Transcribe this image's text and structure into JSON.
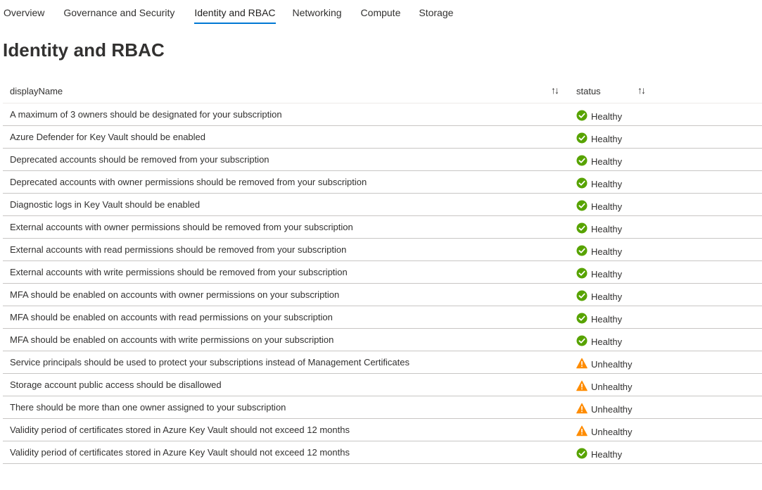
{
  "tabs": [
    {
      "label": "Overview",
      "active": false
    },
    {
      "label": "Governance and Security",
      "active": false
    },
    {
      "label": "Identity and RBAC",
      "active": true
    },
    {
      "label": "Networking",
      "active": false
    },
    {
      "label": "Compute",
      "active": false
    },
    {
      "label": "Storage",
      "active": false
    }
  ],
  "page": {
    "title": "Identity and RBAC"
  },
  "table": {
    "columns": [
      {
        "label": "displayName",
        "sort_icon": "sort-icon"
      },
      {
        "label": "status",
        "sort_icon": "sort-icon"
      }
    ],
    "rows": [
      {
        "name": "A maximum of 3 owners should be designated for your subscription",
        "status": "Healthy",
        "icon": "check-circle-icon"
      },
      {
        "name": "Azure Defender for Key Vault should be enabled",
        "status": "Healthy",
        "icon": "check-circle-icon"
      },
      {
        "name": "Deprecated accounts should be removed from your subscription",
        "status": "Healthy",
        "icon": "check-circle-icon"
      },
      {
        "name": "Deprecated accounts with owner permissions should be removed from your subscription",
        "status": "Healthy",
        "icon": "check-circle-icon"
      },
      {
        "name": "Diagnostic logs in Key Vault should be enabled",
        "status": "Healthy",
        "icon": "check-circle-icon"
      },
      {
        "name": "External accounts with owner permissions should be removed from your subscription",
        "status": "Healthy",
        "icon": "check-circle-icon"
      },
      {
        "name": "External accounts with read permissions should be removed from your subscription",
        "status": "Healthy",
        "icon": "check-circle-icon"
      },
      {
        "name": "External accounts with write permissions should be removed from your subscription",
        "status": "Healthy",
        "icon": "check-circle-icon"
      },
      {
        "name": "MFA should be enabled on accounts with owner permissions on your subscription",
        "status": "Healthy",
        "icon": "check-circle-icon"
      },
      {
        "name": "MFA should be enabled on accounts with read permissions on your subscription",
        "status": "Healthy",
        "icon": "check-circle-icon"
      },
      {
        "name": "MFA should be enabled on accounts with write permissions on your subscription",
        "status": "Healthy",
        "icon": "check-circle-icon"
      },
      {
        "name": "Service principals should be used to protect your subscriptions instead of Management Certificates",
        "status": "Unhealthy",
        "icon": "warning-triangle-icon"
      },
      {
        "name": "Storage account public access should be disallowed",
        "status": "Unhealthy",
        "icon": "warning-triangle-icon"
      },
      {
        "name": "There should be more than one owner assigned to your subscription",
        "status": "Unhealthy",
        "icon": "warning-triangle-icon"
      },
      {
        "name": "Validity period of certificates stored in Azure Key Vault should not exceed 12 months",
        "status": "Unhealthy",
        "icon": "warning-triangle-icon"
      },
      {
        "name": "Validity period of certificates stored in Azure Key Vault should not exceed 12 months",
        "status": "Healthy",
        "icon": "check-circle-icon"
      }
    ]
  },
  "colors": {
    "accent": "#0078d4",
    "healthy": "#57a300",
    "unhealthy": "#ff8c00",
    "text": "#323130"
  }
}
